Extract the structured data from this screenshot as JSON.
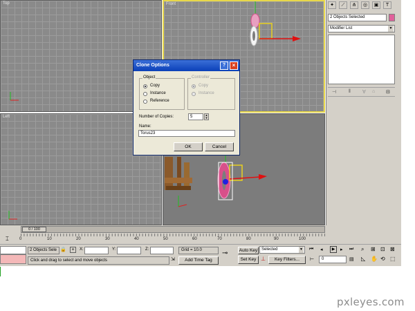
{
  "viewports": {
    "top": {
      "label": "Top"
    },
    "front": {
      "label": "Front"
    },
    "left": {
      "label": "Left"
    }
  },
  "command_panel": {
    "selection_field": "2 Objects Selected",
    "modifier_list": "Modifier List"
  },
  "dialog": {
    "title": "Clone Options",
    "help_label": "?",
    "close_label": "×",
    "object_group": {
      "title": "Object",
      "options": [
        "Copy",
        "Instance",
        "Reference"
      ],
      "selected": "Copy"
    },
    "controller_group": {
      "title": "Controller",
      "options": [
        "Copy",
        "Instance"
      ],
      "selected": "Copy"
    },
    "copies_label": "Number of Copies:",
    "copies_value": "5",
    "name_label": "Name:",
    "name_value": "Torus23",
    "ok_label": "OK",
    "cancel_label": "Cancel"
  },
  "timeline": {
    "frame_counter": "0 / 100",
    "ticks": [
      "0",
      "10",
      "20",
      "30",
      "40",
      "50",
      "60",
      "70",
      "80",
      "90",
      "100"
    ]
  },
  "status_bar": {
    "selection_status": "2 Objects Sele",
    "x_label": "X:",
    "y_label": "Y:",
    "z_label": "Z:",
    "grid": "Grid = 10.0",
    "add_time_tag": "Add Time Tag",
    "auto_key": "Auto Key",
    "set_key": "Set Key",
    "key_mode": "Selected",
    "key_filters": "Key Filters...",
    "current_frame": "0",
    "prompt": "Click and drag to select and move objects"
  },
  "watermark": "pxleyes.com",
  "colors": {
    "viewport_bg": "#8a8a8a",
    "active_border": "#e8d84a",
    "dialog_title": "#0a40b8",
    "torus_pink": "#d8508a",
    "gizmo_red": "#e01010",
    "gizmo_yellow": "#e8d020"
  }
}
